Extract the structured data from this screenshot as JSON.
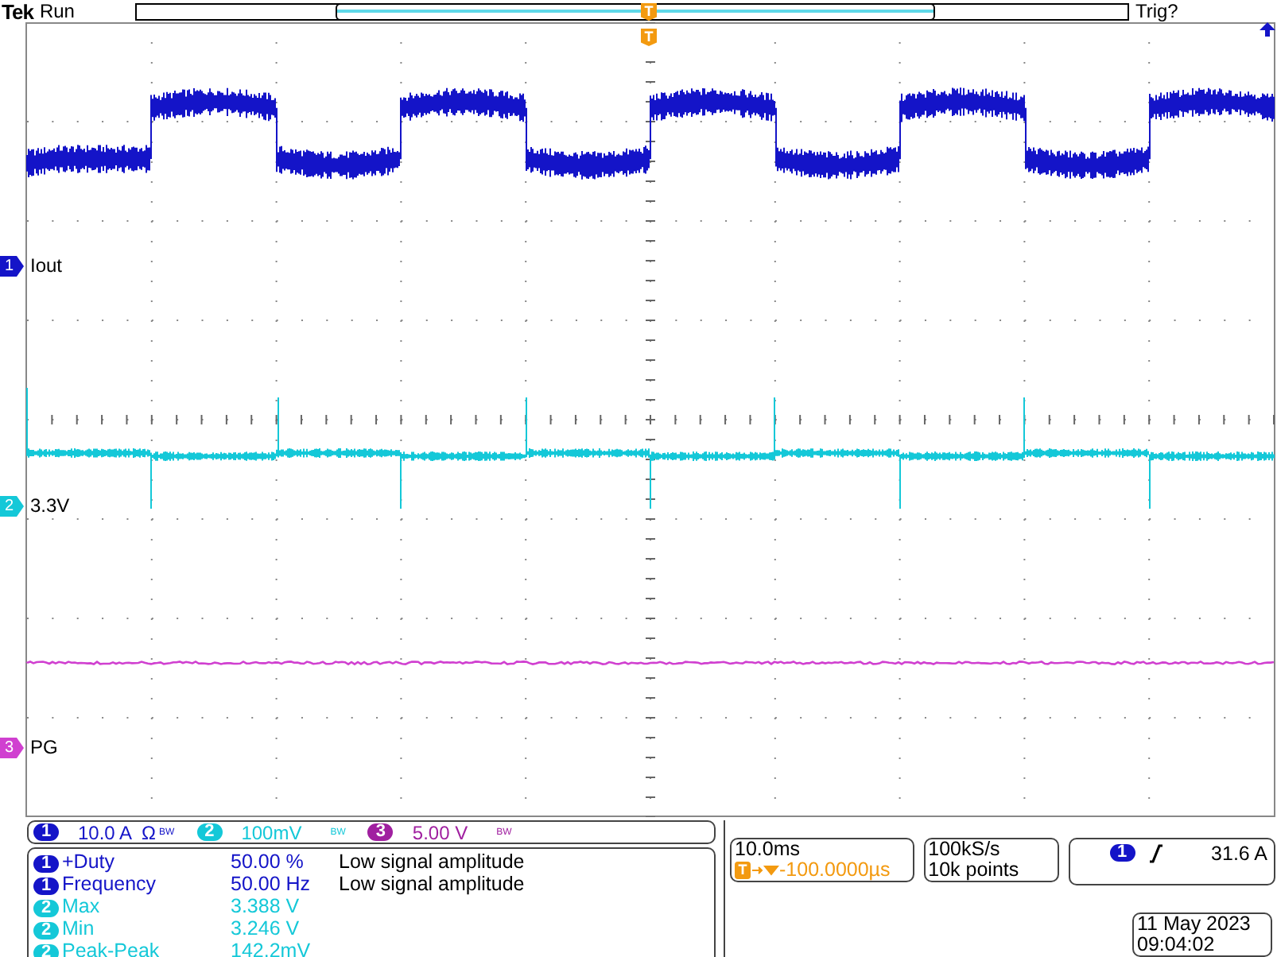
{
  "header": {
    "brand": "Tek",
    "state": "Run",
    "trigger_status": "Trig?",
    "trigger_markers": [
      "T",
      "T"
    ]
  },
  "channels": [
    {
      "number": "1",
      "label": "Iout",
      "color": "#1414c8"
    },
    {
      "number": "2",
      "label": "3.3V",
      "color": "#14c8d8"
    },
    {
      "number": "3",
      "label": "PG",
      "color": "#d040d0"
    }
  ],
  "scales": [
    {
      "badge": "1",
      "color": "#1414c8",
      "value": "10.0 A",
      "unit_mark": "Ω",
      "bw": "BW"
    },
    {
      "badge": "2",
      "color": "#14c8d8",
      "value": "100mV",
      "bw": "BW"
    },
    {
      "badge": "3",
      "color": "#a020a0",
      "value": "5.00 V",
      "bw": "BW"
    }
  ],
  "measurements": [
    {
      "badge": "1",
      "color": "#1414c8",
      "name": "+Duty",
      "value": "50.00 %",
      "note": "Low signal amplitude"
    },
    {
      "badge": "1",
      "color": "#1414c8",
      "name": "Frequency",
      "value": "50.00 Hz",
      "note": "Low signal amplitude"
    },
    {
      "badge": "2",
      "color": "#14c8d8",
      "name": "Max",
      "value": "3.388 V"
    },
    {
      "badge": "2",
      "color": "#14c8d8",
      "name": "Min",
      "value": "3.246 V"
    },
    {
      "badge": "2",
      "color": "#14c8d8",
      "name": "Peak-Peak",
      "value": "142.2mV"
    }
  ],
  "timebase": {
    "scale": "10.0ms",
    "marker": "T",
    "position": "-100.0000µs"
  },
  "acquisition": {
    "sample_rate": "100kS/s",
    "record_length": "10k points"
  },
  "trigger": {
    "badge": "1",
    "color": "#1414c8",
    "level": "31.6 A"
  },
  "clock": {
    "date": "11 May 2023",
    "time": "09:04:02"
  }
}
